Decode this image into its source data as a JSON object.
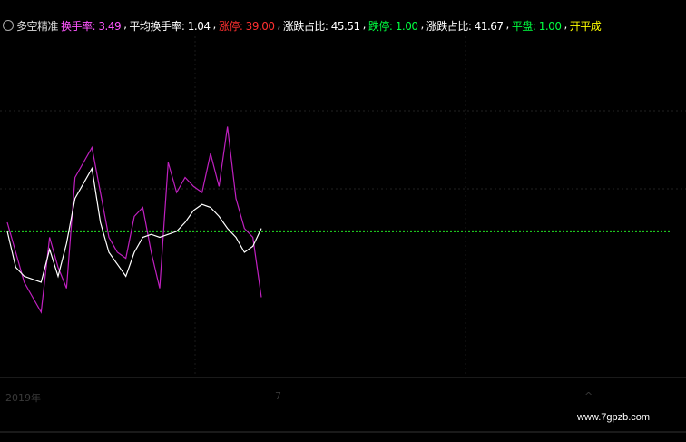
{
  "header": {
    "indicator_name": "多空精准",
    "items": [
      {
        "key": "holding",
        "label": "换手率",
        "value": "3.49",
        "color": "#ff55ff"
      },
      {
        "key": "avg",
        "label": "平均换手率",
        "value": "1.04",
        "color": "#ffffff"
      },
      {
        "key": "up",
        "label": "涨停",
        "value": "39.00",
        "color": "#ff3030"
      },
      {
        "key": "ratio1",
        "label": "涨跌占比",
        "value": "45.51",
        "color": "#ffffff"
      },
      {
        "key": "down",
        "label": "跌停",
        "value": "1.00",
        "color": "#00ff40"
      },
      {
        "key": "ratio2",
        "label": "涨跌占比",
        "value": "41.67",
        "color": "#ffffff"
      },
      {
        "key": "flat",
        "label": "平盘",
        "value": "1.00",
        "color": "#00ff40"
      },
      {
        "key": "extra",
        "label": "开平成",
        "value": "",
        "color": "#ffff00"
      }
    ]
  },
  "watermark": "www.7gpzb.com",
  "axis_labels": {
    "year": "2019年",
    "month": "7",
    "caret": "^"
  },
  "chart_data": {
    "type": "line",
    "ylim": [
      0,
      100
    ],
    "reference_level": 47,
    "series": [
      {
        "color": "#c020c0",
        "values": [
          50,
          40,
          30,
          25,
          20,
          45,
          35,
          28,
          65,
          70,
          75,
          60,
          45,
          40,
          38,
          52,
          55,
          40,
          28,
          70,
          60,
          65,
          62,
          60,
          73,
          62,
          82,
          58,
          48,
          45,
          25,
          null,
          null,
          null,
          null,
          null,
          null,
          null,
          null,
          null,
          null,
          null,
          null,
          null,
          null,
          null,
          null,
          null,
          null,
          null,
          null,
          null,
          null,
          null,
          null,
          null,
          null,
          null,
          null,
          null,
          null,
          null,
          null,
          null,
          null,
          null,
          null,
          null,
          null,
          null,
          null,
          null,
          null,
          null,
          null,
          null,
          null,
          null,
          null
        ]
      },
      {
        "color": "#ffffff",
        "values": [
          47,
          35,
          32,
          31,
          30,
          41,
          32,
          43,
          58,
          63,
          68,
          50,
          40,
          36,
          32,
          40,
          45,
          46,
          45,
          46,
          47,
          50,
          54,
          56,
          55,
          52,
          48,
          45,
          40,
          42,
          48,
          null,
          null,
          null,
          null,
          null,
          null,
          null,
          null,
          null,
          null,
          null,
          null,
          null,
          null,
          null,
          null,
          null,
          null,
          null,
          null,
          null,
          null,
          null,
          null,
          null,
          null,
          null,
          null,
          null,
          null,
          null,
          null,
          null,
          null,
          null,
          null,
          null,
          null,
          null,
          null,
          null,
          null,
          null,
          null,
          null,
          null,
          null,
          null
        ]
      }
    ]
  }
}
